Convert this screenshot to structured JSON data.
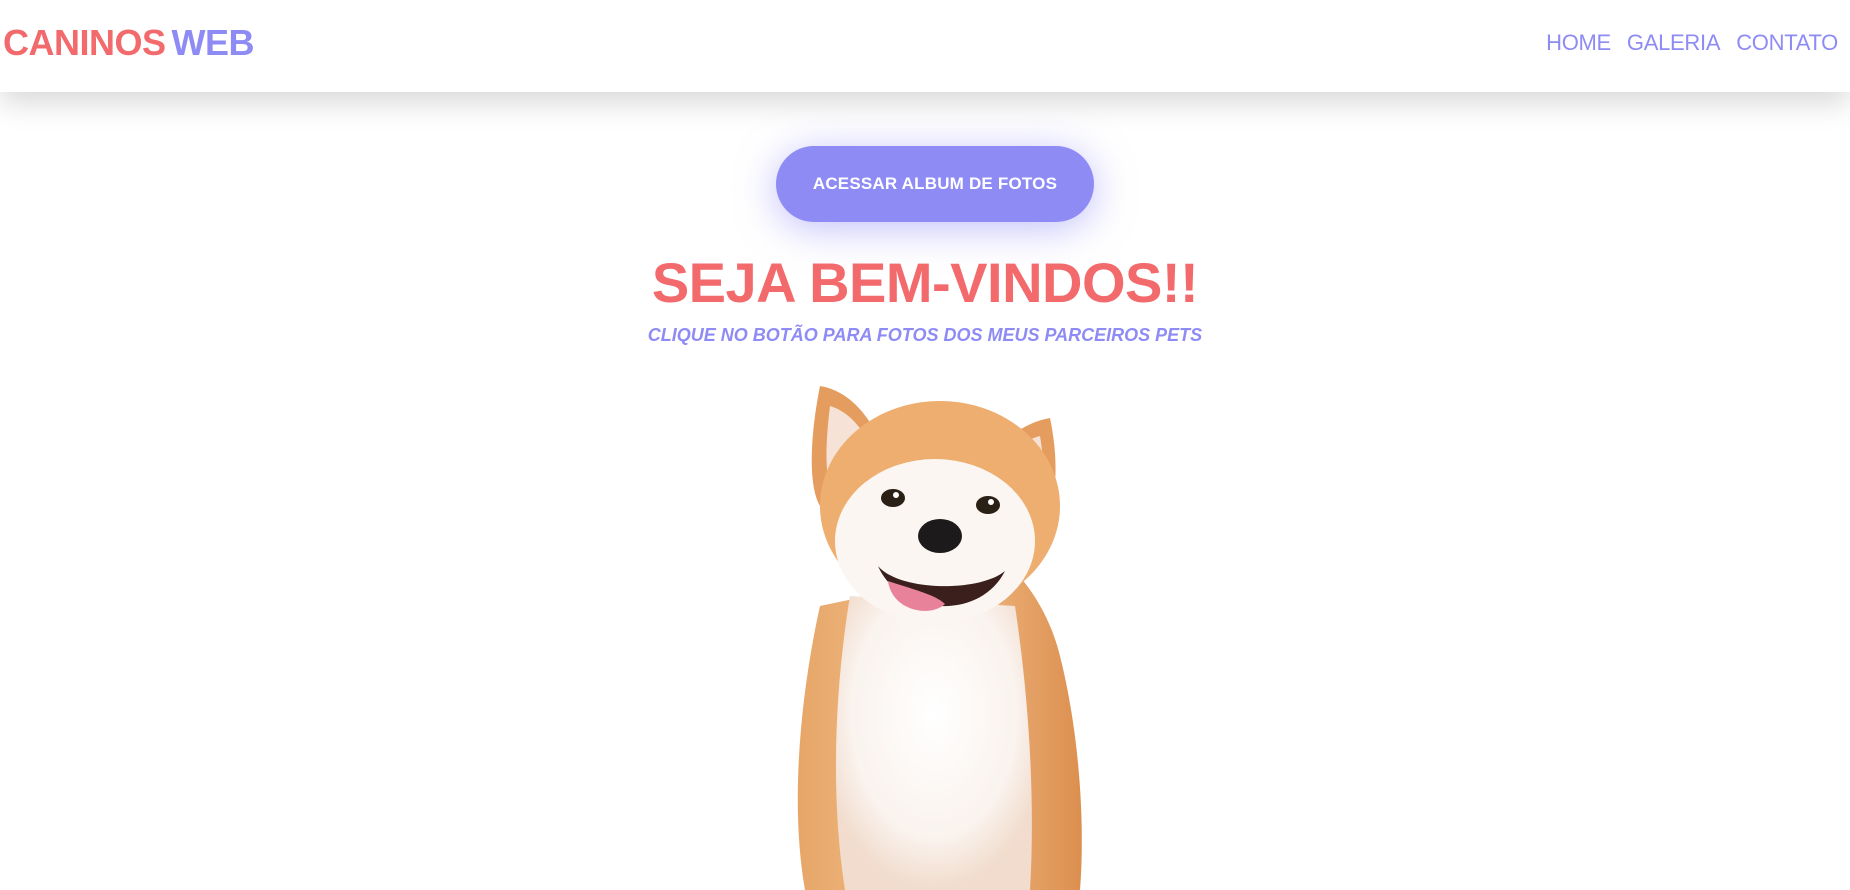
{
  "header": {
    "brand_part1": "CANINOS",
    "brand_part2": "WEB",
    "nav": [
      {
        "label": "HOME"
      },
      {
        "label": "GALERIA"
      },
      {
        "label": "CONTATO"
      }
    ]
  },
  "main": {
    "cta_label": "ACESSAR ALBUM DE FOTOS",
    "title": "SEJA BEM-VINDOS!!",
    "subtitle": "CLIQUE NO BOTÃO PARA FOTOS DOS MEUS PARCEIROS PETS",
    "hero_image": "shiba-inu-dog"
  },
  "colors": {
    "coral": "#f26a6c",
    "lavender": "#8e8bf5",
    "background": "#ffffff"
  }
}
